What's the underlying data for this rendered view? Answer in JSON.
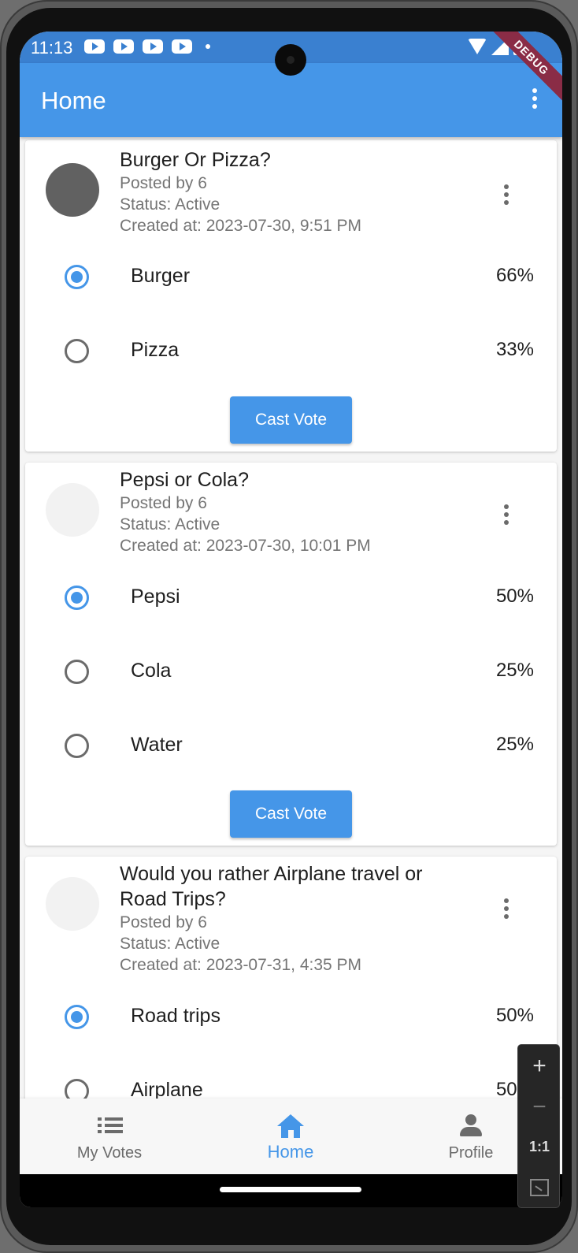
{
  "status_bar": {
    "time": "11:13",
    "debug_label": "DEBUG"
  },
  "app_bar": {
    "title": "Home"
  },
  "polls": [
    {
      "title": "Burger Or Pizza?",
      "posted_by": "Posted by 6",
      "status": "Status: Active",
      "created_at": "Created at: 2023-07-30, 9:51 PM",
      "avatar_color": "#616161",
      "options": [
        {
          "label": "Burger",
          "percent": "66%",
          "selected": true
        },
        {
          "label": "Pizza",
          "percent": "33%",
          "selected": false
        }
      ],
      "button_label": "Cast Vote"
    },
    {
      "title": "Pepsi or Cola?",
      "posted_by": "Posted by 6",
      "status": "Status: Active",
      "created_at": "Created at: 2023-07-30, 10:01 PM",
      "avatar_color": "#f2f2f2",
      "options": [
        {
          "label": "Pepsi",
          "percent": "50%",
          "selected": true
        },
        {
          "label": "Cola",
          "percent": "25%",
          "selected": false
        },
        {
          "label": "Water",
          "percent": "25%",
          "selected": false
        }
      ],
      "button_label": "Cast Vote"
    },
    {
      "title": "Would you rather Airplane travel or Road Trips?",
      "posted_by": "Posted by 6",
      "status": "Status: Active",
      "created_at": "Created at: 2023-07-31, 4:35 PM",
      "avatar_color": "#f2f2f2",
      "options": [
        {
          "label": "Road trips",
          "percent": "50%",
          "selected": true
        },
        {
          "label": "Airplane",
          "percent": "50%",
          "selected": false
        }
      ]
    }
  ],
  "bottom_nav": [
    {
      "label": "My Votes",
      "icon": "list-icon",
      "active": false
    },
    {
      "label": "Home",
      "icon": "home-icon",
      "active": true
    },
    {
      "label": "Profile",
      "icon": "person-icon",
      "active": false
    }
  ],
  "zoom_controls": {
    "zoom_in": "+",
    "zoom_out": "−",
    "actual_size": "1:1",
    "fit_icon": "fit-screen-icon"
  },
  "colors": {
    "primary": "#4596e8",
    "status_bar": "#3a80d0",
    "debug_banner": "#8a2c46"
  }
}
